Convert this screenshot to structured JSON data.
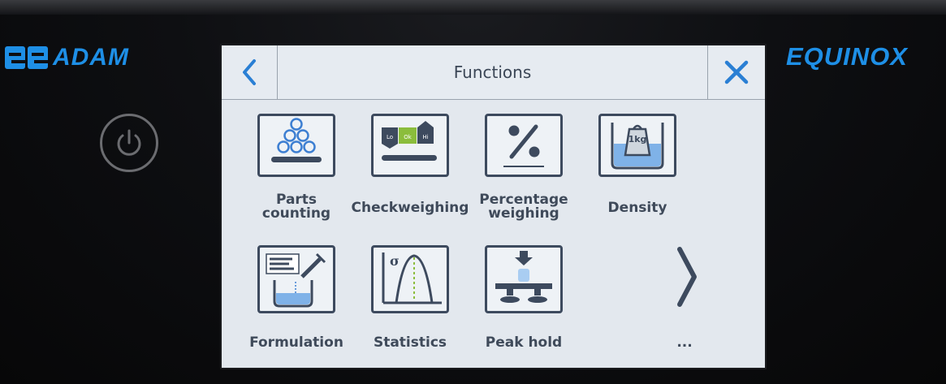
{
  "brand": {
    "left_text": "ADAM",
    "right_text": "EQUINOX",
    "color": "#1e8fe6"
  },
  "screen": {
    "title": "Functions",
    "back_icon": "chevron-left-icon",
    "close_icon": "close-icon",
    "accent": "#2a7fd4"
  },
  "tiles": [
    {
      "label": "Parts\ncounting",
      "icon": "parts-counting-icon"
    },
    {
      "label": "Checkweighing",
      "icon": "checkweighing-icon",
      "badges": [
        "Lo",
        "Ok",
        "Hi"
      ]
    },
    {
      "label": "Percentage\nweighing",
      "icon": "percentage-icon"
    },
    {
      "label": "Density",
      "icon": "density-icon",
      "weight_text": "1kg"
    },
    {
      "label": "Formulation",
      "icon": "formulation-icon"
    },
    {
      "label": "Statistics",
      "icon": "statistics-icon",
      "symbol": "σ"
    },
    {
      "label": "Peak hold",
      "icon": "peak-hold-icon"
    }
  ],
  "more_label": "...",
  "next_icon": "chevron-right-icon"
}
